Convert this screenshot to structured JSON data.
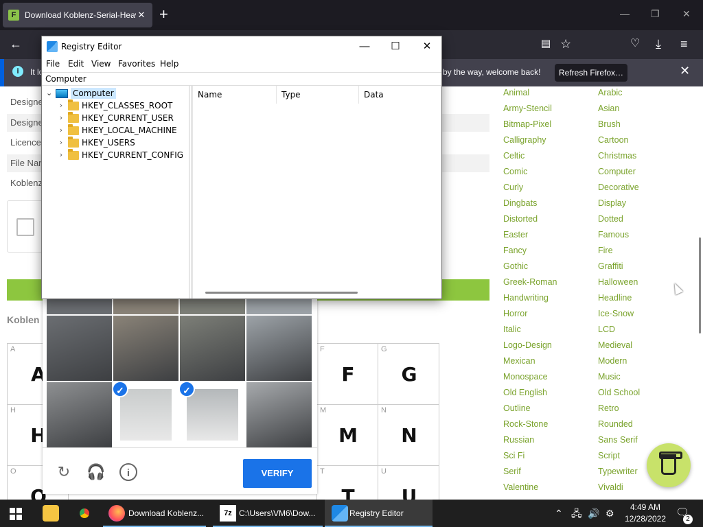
{
  "browser": {
    "tab_title": "Download Koblenz-Serial-Heav",
    "new_tab": "+",
    "notification": {
      "message_left": "It lo",
      "message_right": "by the way, welcome back!",
      "refresh_button": "Refresh Firefox…"
    }
  },
  "page": {
    "info_rows": [
      "Designe",
      "Designe",
      "Licence",
      "File Nar",
      "Koblenz"
    ],
    "section_title": "Koblen",
    "glyphs": [
      {
        "label": "A",
        "glyph": "A"
      },
      {
        "label": "F",
        "glyph": "F"
      },
      {
        "label": "G",
        "glyph": "G"
      },
      {
        "label": "H",
        "glyph": "H"
      },
      {
        "label": "M",
        "glyph": "M"
      },
      {
        "label": "N",
        "glyph": "N"
      },
      {
        "label": "O",
        "glyph": "O"
      },
      {
        "label": "T",
        "glyph": "T"
      },
      {
        "label": "U",
        "glyph": "U"
      }
    ],
    "categories_left": [
      "Animal",
      "Army-Stencil",
      "Bitmap-Pixel",
      "Calligraphy",
      "Celtic",
      "Comic",
      "Curly",
      "Dingbats",
      "Distorted",
      "Easter",
      "Fancy",
      "Gothic",
      "Greek-Roman",
      "Handwriting",
      "Horror",
      "Italic",
      "Logo-Design",
      "Mexican",
      "Monospace",
      "Old English",
      "Outline",
      "Rock-Stone",
      "Russian",
      "Sci Fi",
      "Serif",
      "Valentine"
    ],
    "categories_right": [
      "Arabic",
      "Asian",
      "Brush",
      "Cartoon",
      "Christmas",
      "Computer",
      "Decorative",
      "Display",
      "Dotted",
      "Famous",
      "Fire",
      "Graffiti",
      "Halloween",
      "Headline",
      "Ice-Snow",
      "LCD",
      "Medieval",
      "Modern",
      "Music",
      "Old School",
      "Retro",
      "Rounded",
      "Sans Serif",
      "Script",
      "Typewriter",
      "Vivaldi"
    ]
  },
  "captcha": {
    "verify_label": "VERIFY",
    "selected_tiles": [
      5,
      6
    ]
  },
  "regedit": {
    "title": "Registry Editor",
    "menu": [
      "File",
      "Edit",
      "View",
      "Favorites",
      "Help"
    ],
    "address": "Computer",
    "root": "Computer",
    "hives": [
      "HKEY_CLASSES_ROOT",
      "HKEY_CURRENT_USER",
      "HKEY_LOCAL_MACHINE",
      "HKEY_USERS",
      "HKEY_CURRENT_CONFIG"
    ],
    "columns": [
      "Name",
      "Type",
      "Data"
    ]
  },
  "taskbar": {
    "items": [
      {
        "label": "Download Koblenz...",
        "active": false
      },
      {
        "label": "C:\\Users\\VM6\\Dow...",
        "active": false
      },
      {
        "label": "Registry Editor",
        "active": true
      }
    ],
    "app_7z": "7z",
    "time": "4:49 AM",
    "date": "12/28/2022",
    "notification_count": "2"
  },
  "colors": {
    "accent_green": "#8dc63f",
    "link_green": "#7aa32c",
    "verify_blue": "#1a73e8",
    "firefox_dark": "#1c1b22"
  }
}
